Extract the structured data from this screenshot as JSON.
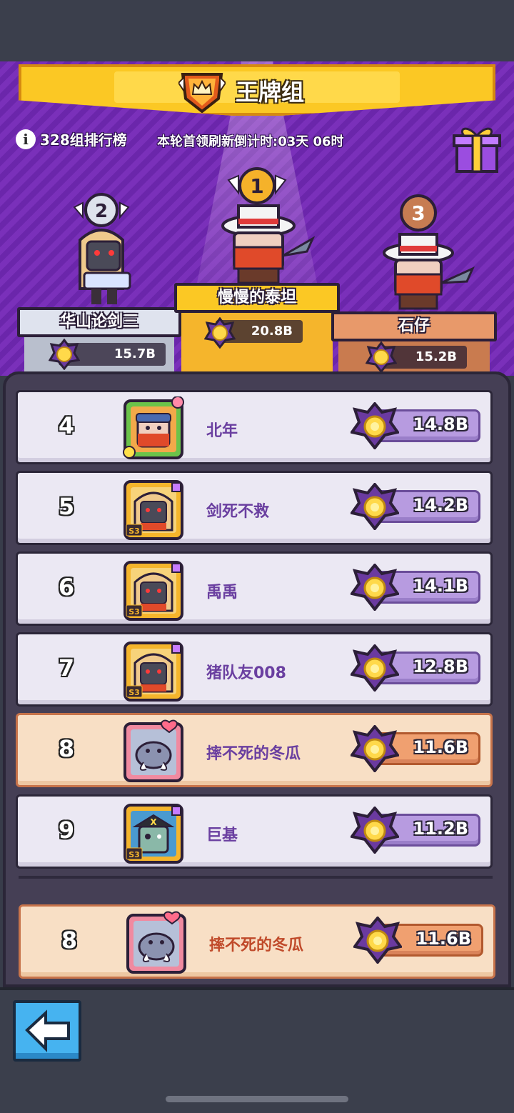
{
  "header": {
    "title": "王牌组",
    "leaderboard_label": "328组排行榜",
    "countdown_label": "本轮首领刷新倒计时:03天 06时"
  },
  "podium": [
    {
      "place": "1",
      "name": "慢慢的泰坦",
      "score": "20.8B"
    },
    {
      "place": "2",
      "name": "华山论剑三",
      "score": "15.7B"
    },
    {
      "place": "3",
      "name": "石仔",
      "score": "15.2B"
    }
  ],
  "rows": [
    {
      "rank": "4",
      "name": "北年",
      "score": "14.8B",
      "highlight": false,
      "avatar": "ninja-goggles",
      "season": ""
    },
    {
      "rank": "5",
      "name": "剑死不救",
      "score": "14.2B",
      "highlight": false,
      "avatar": "hooded-robot",
      "season": "S3"
    },
    {
      "rank": "6",
      "name": "禹禹",
      "score": "14.1B",
      "highlight": false,
      "avatar": "hooded-robot",
      "season": "S3"
    },
    {
      "rank": "7",
      "name": "猪队友008",
      "score": "12.8B",
      "highlight": false,
      "avatar": "hooded-robot",
      "season": "S3"
    },
    {
      "rank": "8",
      "name": "摔不死的冬瓜",
      "score": "11.6B",
      "highlight": true,
      "avatar": "boar",
      "season": ""
    },
    {
      "rank": "9",
      "name": "巨基",
      "score": "11.2B",
      "highlight": false,
      "avatar": "pirate-zombie",
      "season": "S3"
    }
  ],
  "self_row": {
    "rank": "8",
    "name": "摔不死的冬瓜",
    "score": "11.6B"
  },
  "colors": {
    "accent": "#fbc824",
    "purple": "#6b26ab",
    "name_text": "#6a3fa0"
  },
  "icons": {
    "info": "i",
    "back": "left-arrow-icon",
    "gift": "gift-box-icon",
    "medal": "purple-star-medal-icon"
  }
}
